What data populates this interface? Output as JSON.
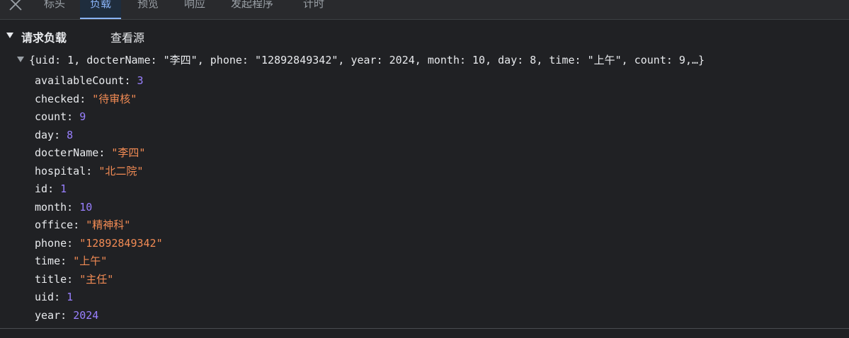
{
  "tabs": [
    "标头",
    "负载",
    "预览",
    "响应",
    "发起程序",
    "计时"
  ],
  "active_tab": "负载",
  "section": {
    "title": "请求负载",
    "view_source": "查看源"
  },
  "summary": "{uid: 1, docterName: \"李四\", phone: \"12892849342\", year: 2024, month: 10, day: 8, time: \"上午\", count: 9,…}",
  "props": [
    {
      "key": "availableCount",
      "value": "3",
      "kind": "number"
    },
    {
      "key": "checked",
      "value": "\"待审核\"",
      "kind": "string"
    },
    {
      "key": "count",
      "value": "9",
      "kind": "number"
    },
    {
      "key": "day",
      "value": "8",
      "kind": "number"
    },
    {
      "key": "docterName",
      "value": "\"李四\"",
      "kind": "string"
    },
    {
      "key": "hospital",
      "value": "\"北二院\"",
      "kind": "string"
    },
    {
      "key": "id",
      "value": "1",
      "kind": "number"
    },
    {
      "key": "month",
      "value": "10",
      "kind": "number"
    },
    {
      "key": "office",
      "value": "\"精神科\"",
      "kind": "string"
    },
    {
      "key": "phone",
      "value": "\"12892849342\"",
      "kind": "string"
    },
    {
      "key": "time",
      "value": "\"上午\"",
      "kind": "string"
    },
    {
      "key": "title",
      "value": "\"主任\"",
      "kind": "string"
    },
    {
      "key": "uid",
      "value": "1",
      "kind": "number"
    },
    {
      "key": "year",
      "value": "2024",
      "kind": "number"
    }
  ],
  "colors": {
    "background": "#202124",
    "accent": "#8ab4f8",
    "number": "#9980ff",
    "string": "#f28b54"
  },
  "icons": {
    "close": "close-icon",
    "section_toggle": "triangle-down-icon",
    "object_toggle": "triangle-down-icon"
  }
}
